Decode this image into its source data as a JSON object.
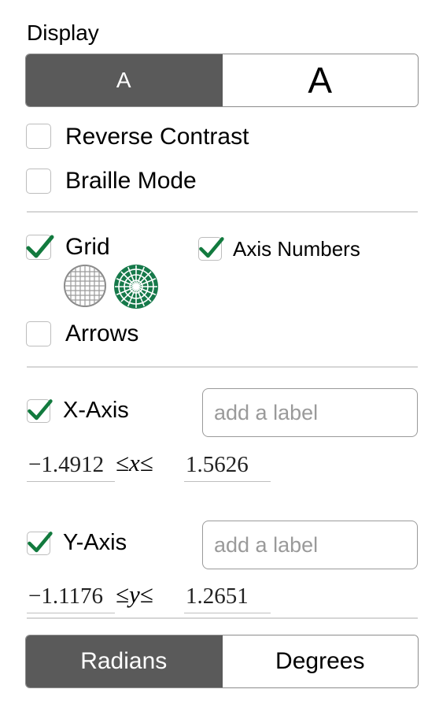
{
  "display": {
    "heading": "Display",
    "text_size": {
      "small_label": "A",
      "large_label": "A",
      "selected": "small"
    }
  },
  "options": {
    "reverse_contrast": {
      "label": "Reverse Contrast",
      "checked": false
    },
    "braille_mode": {
      "label": "Braille Mode",
      "checked": false
    },
    "grid": {
      "label": "Grid",
      "checked": true
    },
    "axis_numbers": {
      "label": "Axis Numbers",
      "checked": true
    },
    "arrows": {
      "label": "Arrows",
      "checked": false
    }
  },
  "grid_styles": [
    {
      "name": "cartesian",
      "selected": false
    },
    {
      "name": "polar",
      "selected": true
    }
  ],
  "x_axis": {
    "label": "X-Axis",
    "checked": true,
    "label_placeholder": "add a label",
    "min": "−1.4912",
    "max": "1.5626",
    "variable": "x",
    "leq": "≤"
  },
  "y_axis": {
    "label": "Y-Axis",
    "checked": true,
    "label_placeholder": "add a label",
    "min": "−1.1176",
    "max": "1.2651",
    "variable": "y",
    "leq": "≤"
  },
  "angle_units": {
    "radians_label": "Radians",
    "degrees_label": "Degrees",
    "selected": "radians"
  },
  "colors": {
    "check_green": "#127a3e",
    "active_segment": "#5a5a5a",
    "polar_green": "#16794a"
  }
}
